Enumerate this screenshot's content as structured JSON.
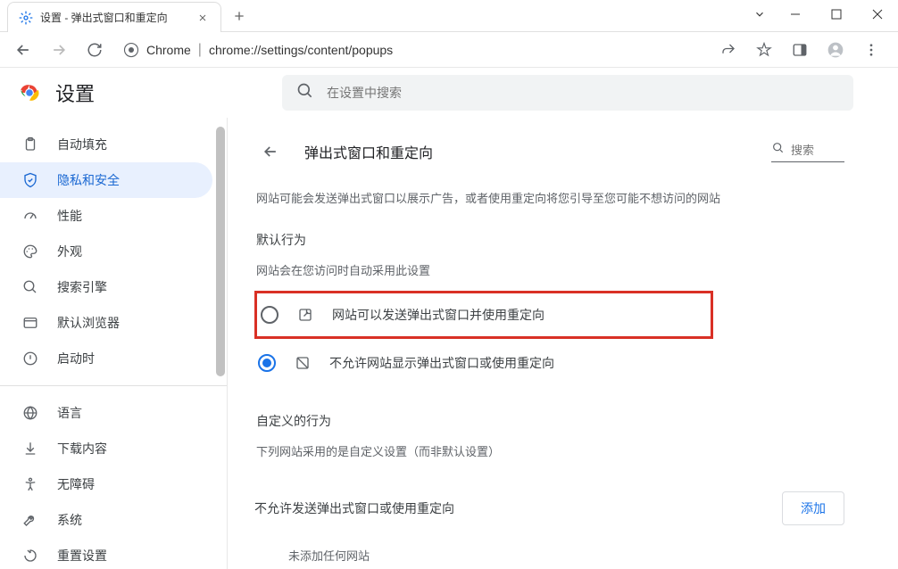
{
  "window": {
    "tab_title": "设置 - 弹出式窗口和重定向",
    "url_prefix": "Chrome",
    "url_path": "chrome://settings/content/popups"
  },
  "header": {
    "title": "设置",
    "search_placeholder": "在设置中搜索"
  },
  "sidebar": {
    "items": [
      {
        "icon": "clipboard",
        "label": "自动填充"
      },
      {
        "icon": "shield",
        "label": "隐私和安全"
      },
      {
        "icon": "gauge",
        "label": "性能"
      },
      {
        "icon": "palette",
        "label": "外观"
      },
      {
        "icon": "search",
        "label": "搜索引擎"
      },
      {
        "icon": "browser",
        "label": "默认浏览器"
      },
      {
        "icon": "power",
        "label": "启动时"
      },
      {
        "icon": "globe",
        "label": "语言"
      },
      {
        "icon": "download",
        "label": "下载内容"
      },
      {
        "icon": "accessibility",
        "label": "无障碍"
      },
      {
        "icon": "wrench",
        "label": "系统"
      },
      {
        "icon": "reset",
        "label": "重置设置"
      }
    ]
  },
  "page": {
    "title": "弹出式窗口和重定向",
    "search_label": "搜索",
    "description": "网站可能会发送弹出式窗口以展示广告，或者使用重定向将您引导至您可能不想访问的网站",
    "default_behavior_label": "默认行为",
    "default_behavior_sub": "网站会在您访问时自动采用此设置",
    "radio_allow": "网站可以发送弹出式窗口并使用重定向",
    "radio_block": "不允许网站显示弹出式窗口或使用重定向",
    "custom_behavior_label": "自定义的行为",
    "custom_behavior_sub": "下列网站采用的是自定义设置（而非默认设置）",
    "block_exception_label": "不允许发送弹出式窗口或使用重定向",
    "add_button": "添加",
    "empty_list": "未添加任何网站"
  }
}
